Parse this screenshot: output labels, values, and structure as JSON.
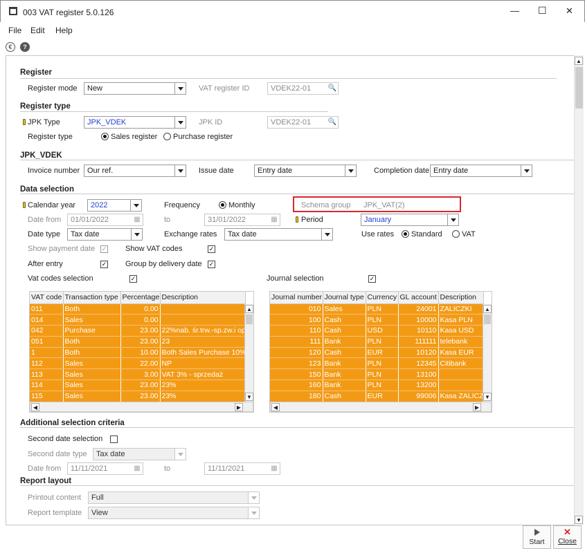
{
  "window": {
    "title": "003 VAT register 5.0.126",
    "min": "—",
    "max": "☐",
    "close": "✕"
  },
  "menu": [
    {
      "label": "File"
    },
    {
      "label": "Edit"
    },
    {
      "label": "Help"
    }
  ],
  "register": {
    "section": "Register",
    "mode_label": "Register mode",
    "mode_value": "New",
    "id_label": "VAT register ID",
    "id_value": "VDEK22-01"
  },
  "register_type": {
    "section": "Register type",
    "jpk_type_label": "JPK Type",
    "jpk_type_value": "JPK_VDEK",
    "jpk_id_label": "JPK ID",
    "jpk_id_value": "VDEK22-01",
    "type_label": "Register type",
    "sales": "Sales register",
    "purchase": "Purchase register"
  },
  "jpk_vdek": {
    "section": "JPK_VDEK",
    "invoice_label": "Invoice number",
    "invoice_value": "Our ref.",
    "issue_label": "Issue date",
    "issue_value": "Entry date",
    "completion_label": "Completion date",
    "completion_value": "Entry date"
  },
  "data_selection": {
    "section": "Data selection",
    "year_label": "Calendar year",
    "year_value": "2022",
    "frequency_label": "Frequency",
    "frequency_value": "Monthly",
    "schema_label": "Schema group",
    "schema_value": "JPK_VAT(2)",
    "date_from_label": "Date from",
    "date_from": "01/01/2022",
    "to_label": "to",
    "date_to": "31/01/2022",
    "period_label": "Period",
    "period_value": "January",
    "date_type_label": "Date type",
    "date_type_value": "Tax date",
    "exch_label": "Exchange rates",
    "exch_value": "Tax date",
    "use_rates_label": "Use rates",
    "standard": "Standard",
    "vat": "VAT",
    "show_payment": "Show payment date",
    "show_vat_codes": "Show VAT codes",
    "after_entry": "After entry",
    "group_delivery": "Group by delivery date",
    "vat_selection": "Vat codes selection",
    "journal_selection": "Journal selection"
  },
  "vat_table": {
    "headers": [
      "VAT code",
      "Transaction type",
      "Percentage",
      "Description"
    ],
    "rows": [
      [
        "011",
        "Both",
        "0.00",
        ""
      ],
      [
        "014",
        "Sales",
        "0.00",
        ""
      ],
      [
        "042",
        "Purchase",
        "23.00",
        "22%nab. śr.trw.-sp.zw.i op"
      ],
      [
        "051",
        "Both",
        "23.00",
        "23"
      ],
      [
        "1",
        "Both",
        "10.00",
        "Both Sales Purchase 10%"
      ],
      [
        "112",
        "Sales",
        "22.00",
        "NP"
      ],
      [
        "113",
        "Sales",
        "3.00",
        "VAT 3% - sprzedaż"
      ],
      [
        "114",
        "Sales",
        "23.00",
        "23%"
      ],
      [
        "115",
        "Sales",
        "23.00",
        "23%"
      ]
    ]
  },
  "journal_table": {
    "headers": [
      "Journal number",
      "Journal type",
      "Currency",
      "GL account",
      "Description"
    ],
    "rows": [
      [
        "010",
        "Sales",
        "PLN",
        "24001",
        "ZALICZKI"
      ],
      [
        "100",
        "Cash",
        "PLN",
        "10000",
        "Kasa PLN"
      ],
      [
        "110",
        "Cash",
        "USD",
        "10110",
        "Kasa USD"
      ],
      [
        "111",
        "Bank",
        "PLN",
        "111111",
        "telebank"
      ],
      [
        "120",
        "Cash",
        "EUR",
        "10120",
        "Kasa EUR"
      ],
      [
        "123",
        "Bank",
        "PLN",
        "12345",
        "Citibank"
      ],
      [
        "150",
        "Bank",
        "PLN",
        "13100",
        ""
      ],
      [
        "160",
        "Bank",
        "PLN",
        "13200",
        ""
      ],
      [
        "180",
        "Cash",
        "EUR",
        "99006",
        "Kasa ZALICZKI"
      ]
    ]
  },
  "additional": {
    "section": "Additional selection criteria",
    "second_label": "Second date selection",
    "second_type_label": "Second date type",
    "second_type_value": "Tax date",
    "date_from_label": "Date from",
    "date_from": "11/11/2021",
    "to_label": "to",
    "date_to": "11/11/2021"
  },
  "report": {
    "section": "Report layout",
    "printout_label": "Printout content",
    "printout_value": "Full",
    "template_label": "Report template",
    "template_value": "View"
  },
  "buttons": {
    "start": "Start",
    "close": "Close"
  },
  "colors": {
    "row": "#f39a15",
    "highlight": "#d9252b",
    "accent_blue": "#1f3fcf"
  }
}
